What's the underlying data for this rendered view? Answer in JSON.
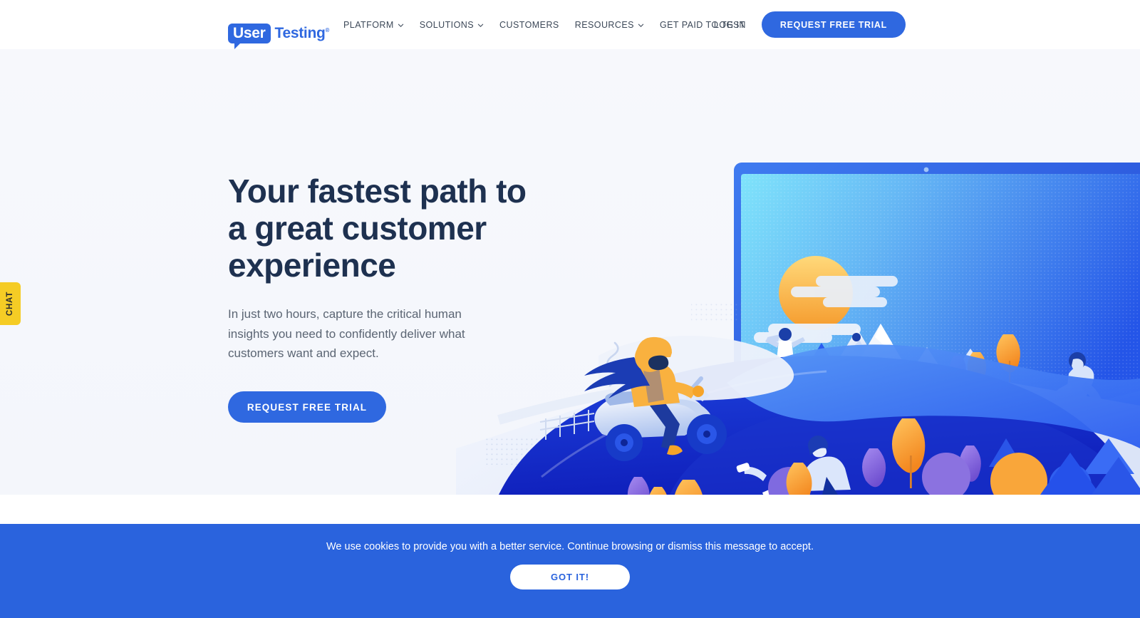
{
  "header": {
    "logo": {
      "badge_text": "User",
      "word_text": "Testing",
      "tm": "®"
    },
    "nav": [
      {
        "label": "PLATFORM",
        "has_chevron": true,
        "icon": "chevron-down-icon"
      },
      {
        "label": "SOLUTIONS",
        "has_chevron": true,
        "icon": "chevron-down-icon"
      },
      {
        "label": "CUSTOMERS",
        "has_chevron": false,
        "icon": ""
      },
      {
        "label": "RESOURCES",
        "has_chevron": true,
        "icon": "chevron-down-icon"
      },
      {
        "label": "GET PAID TO TEST",
        "has_chevron": false,
        "icon": ""
      }
    ],
    "login_label": "LOG IN",
    "cta_label": "REQUEST FREE TRIAL"
  },
  "hero": {
    "title": "Your fastest path to a great customer experience",
    "subtitle": "In just two hours, capture the critical human insights you need to confidently deliver what customers want and expect.",
    "cta_label": "REQUEST FREE TRIAL",
    "illustration_name": "laptop-landscape-illustration"
  },
  "chat": {
    "label": "CHAT"
  },
  "cookie": {
    "message": "We use cookies to provide you with a better service. Continue browsing or dismiss this message to accept.",
    "accept_label": "GOT IT!"
  },
  "colors": {
    "brand_blue": "#2f68e0",
    "banner_blue": "#2a63dd",
    "heading_navy": "#1e3150",
    "body_grey": "#5b6573",
    "hero_bg": "#f7f8fc",
    "chat_yellow": "#f5cc25",
    "accent_orange": "#f9a63a",
    "accent_purple": "#8b72e0"
  }
}
